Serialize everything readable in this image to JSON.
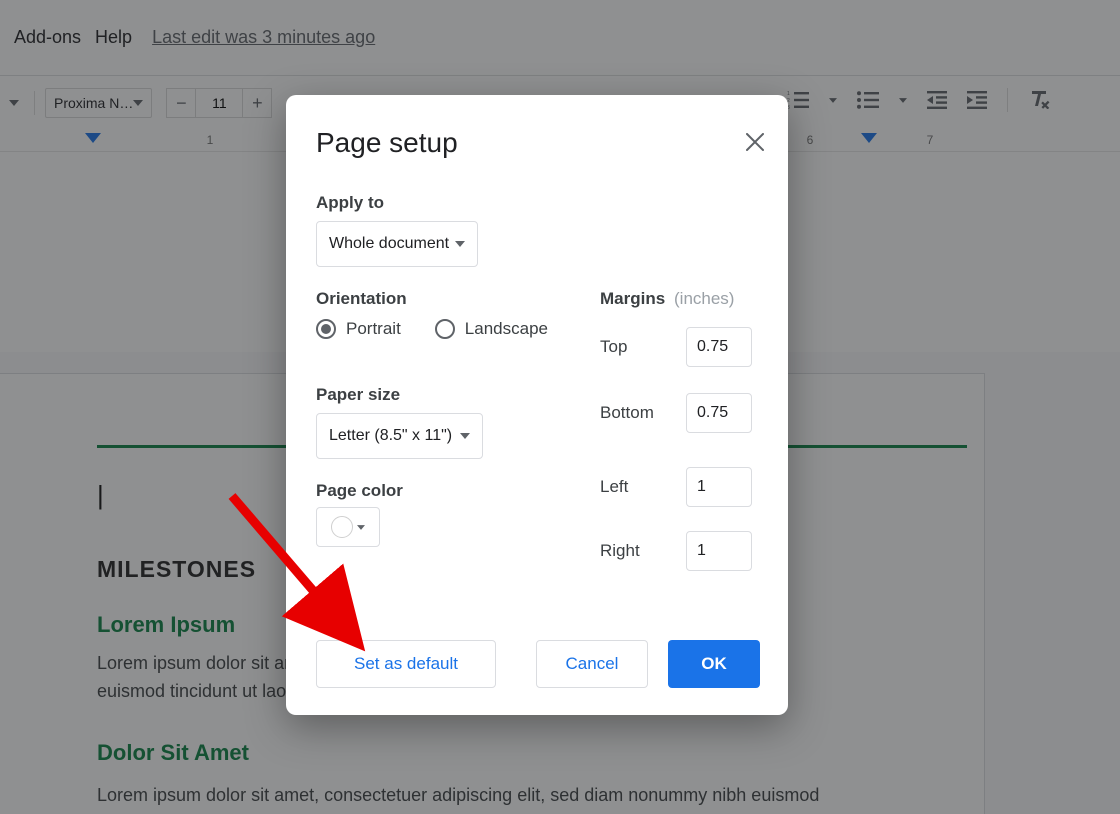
{
  "menubar": {
    "addons": "Add-ons",
    "help": "Help",
    "last_edit": "Last edit was 3 minutes ago"
  },
  "toolbar": {
    "font_name": "Proxima N…",
    "font_size": "11"
  },
  "ruler": {
    "num_1": "1",
    "num_6": "6",
    "num_7": "7"
  },
  "doc": {
    "milestones": "MILESTONES",
    "heading1": "Lorem Ipsum",
    "para1": "Lorem ipsum dolor sit amet, consectetuer adipiscing elit, sed diam nonummy nibh euismod tincidunt ut laoreet dolore ut wisi enim ad minim veniam",
    "heading2": "Dolor Sit Amet",
    "para2": "Lorem ipsum dolor sit amet, consectetuer adipiscing elit, sed diam nonummy nibh euismod"
  },
  "dialog": {
    "title": "Page setup",
    "apply_to_label": "Apply to",
    "apply_to_value": "Whole document",
    "orientation_label": "Orientation",
    "portrait": "Portrait",
    "landscape": "Landscape",
    "paper_size_label": "Paper size",
    "paper_size_value": "Letter (8.5\" x 11\")",
    "page_color_label": "Page color",
    "margins_label": "Margins",
    "margins_unit": "(inches)",
    "top_label": "Top",
    "bottom_label": "Bottom",
    "left_label": "Left",
    "right_label": "Right",
    "top_value": "0.75",
    "bottom_value": "0.75",
    "left_value": "1",
    "right_value": "1",
    "set_default": "Set as default",
    "cancel": "Cancel",
    "ok": "OK"
  }
}
